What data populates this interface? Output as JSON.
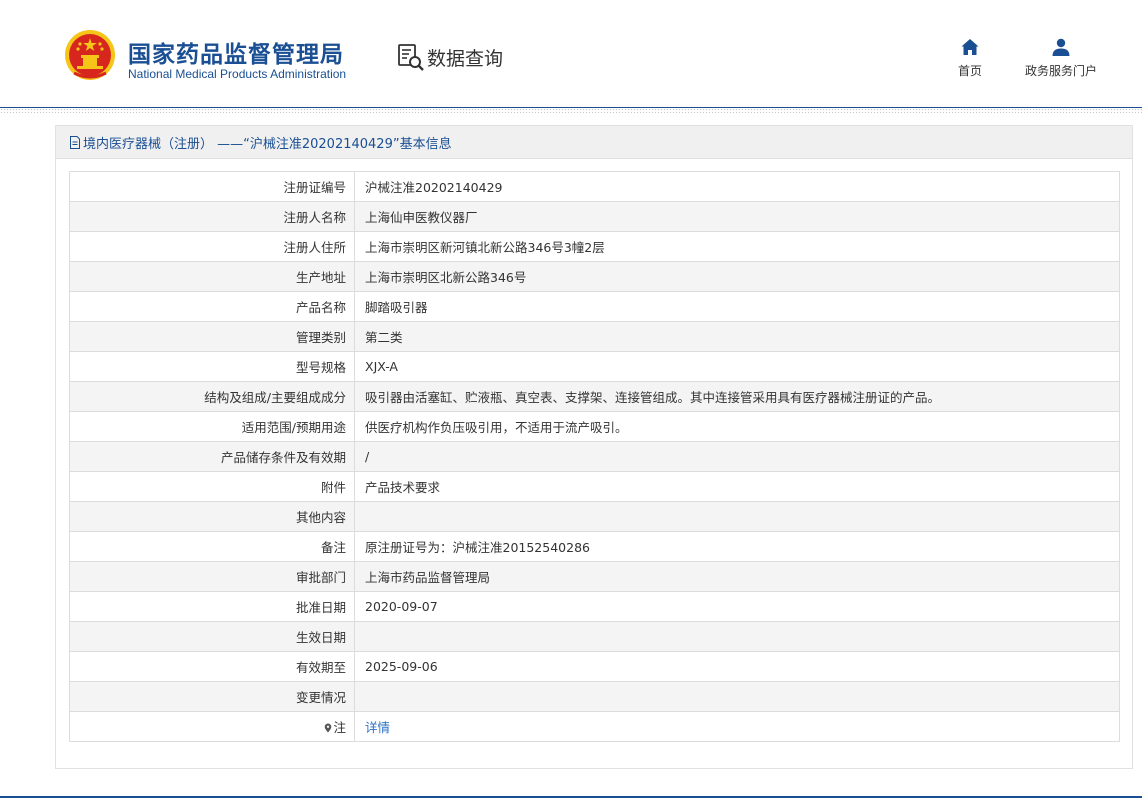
{
  "header": {
    "logo_cn": "国家药品监督管理局",
    "logo_en": "National Medical Products Administration",
    "section_title": "数据查询",
    "nav": [
      {
        "label": "首页",
        "icon": "home-icon"
      },
      {
        "label": "政务服务门户",
        "icon": "user-icon"
      }
    ]
  },
  "panel": {
    "title": "境内医疗器械（注册） ——“沪械注准20202140429”基本信息"
  },
  "rows": [
    {
      "label": "注册证编号",
      "value": "沪械注准20202140429"
    },
    {
      "label": "注册人名称",
      "value": "上海仙申医教仪器厂"
    },
    {
      "label": "注册人住所",
      "value": "上海市崇明区新河镇北新公路346号3幢2层"
    },
    {
      "label": "生产地址",
      "value": "上海市崇明区北新公路346号"
    },
    {
      "label": "产品名称",
      "value": "脚踏吸引器"
    },
    {
      "label": "管理类别",
      "value": "第二类"
    },
    {
      "label": "型号规格",
      "value": "XJX-A"
    },
    {
      "label": "结构及组成/主要组成成分",
      "value": "吸引器由活塞缸、贮液瓶、真空表、支撑架、连接管组成。其中连接管采用具有医疗器械注册证的产品。"
    },
    {
      "label": "适用范围/预期用途",
      "value": "供医疗机构作负压吸引用，不适用于流产吸引。"
    },
    {
      "label": "产品储存条件及有效期",
      "value": "/"
    },
    {
      "label": "附件",
      "value": "产品技术要求"
    },
    {
      "label": "其他内容",
      "value": ""
    },
    {
      "label": "备注",
      "value": "原注册证号为：沪械注准20152540286"
    },
    {
      "label": "审批部门",
      "value": "上海市药品监督管理局"
    },
    {
      "label": "批准日期",
      "value": "2020-09-07"
    },
    {
      "label": "生效日期",
      "value": ""
    },
    {
      "label": "有效期至",
      "value": "2025-09-06"
    },
    {
      "label": "变更情况",
      "value": ""
    }
  ],
  "note_row": {
    "label": "注",
    "link": "详情",
    "icon": "pin-icon"
  },
  "colors": {
    "brand": "#1a4f93",
    "link": "#2a6fc6",
    "emblem_red": "#d7261e",
    "emblem_gold": "#f5c518"
  }
}
